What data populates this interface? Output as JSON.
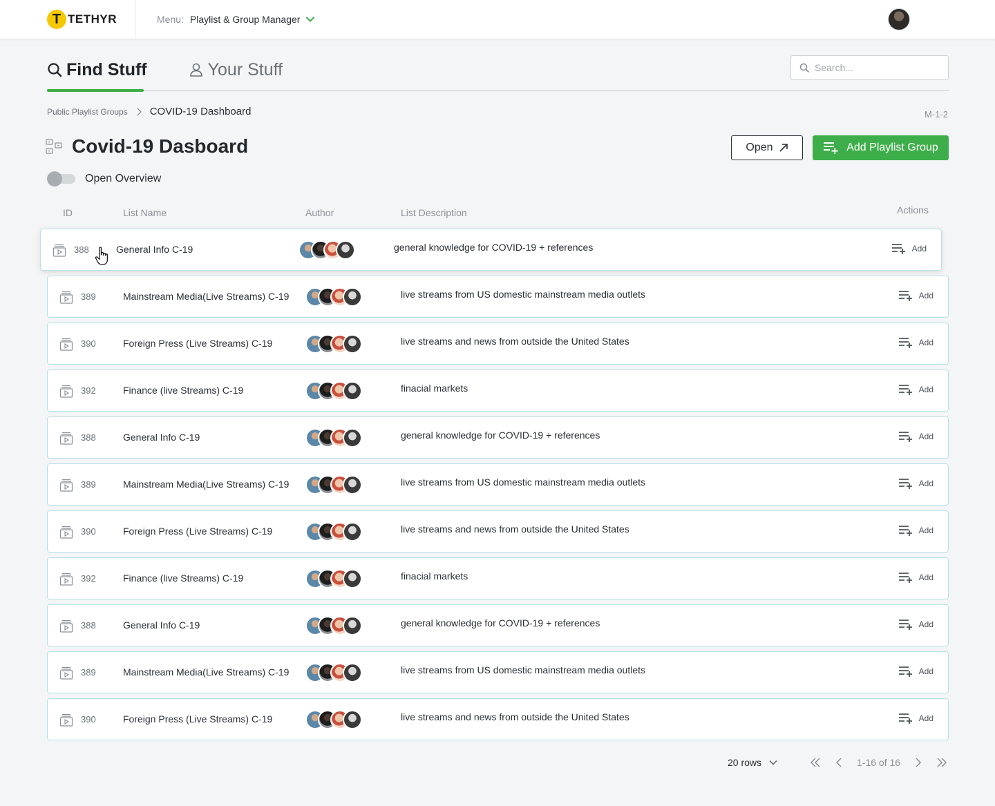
{
  "app": {
    "logo_letter": "T",
    "logo_text": "TETHYR",
    "menu_label": "Menu:",
    "menu_value": "Playlist & Group Manager"
  },
  "tabs": [
    {
      "label": "Find Stuff",
      "active": true
    },
    {
      "label": "Your Stuff",
      "active": false
    }
  ],
  "search": {
    "placeholder": "Search..."
  },
  "breadcrumb": {
    "parent": "Public Playlist Groups",
    "current": "COVID-19 Dashboard"
  },
  "page_code": "M-1-2",
  "page_title": "Covid-19 Dasboard",
  "buttons": {
    "open": "Open",
    "add_group": "Add Playlist Group"
  },
  "toggle": {
    "label": "Open Overview",
    "on": false
  },
  "table": {
    "headers": {
      "id": "ID",
      "name": "List Name",
      "author": "Author",
      "description": "List Description",
      "actions": "Actions"
    },
    "add_label": "Add",
    "rows": [
      {
        "id": "388",
        "name": "General Info C-19",
        "description": "general knowledge for COVID-19 + references"
      },
      {
        "id": "389",
        "name": "Mainstream Media(Live Streams) C-19",
        "description": "live streams from US domestic mainstream media outlets"
      },
      {
        "id": "390",
        "name": "Foreign Press (Live Streams) C-19",
        "description": "live streams and news from outside the United States"
      },
      {
        "id": "392",
        "name": "Finance (live Streams) C-19",
        "description": "finacial markets"
      },
      {
        "id": "388",
        "name": "General Info C-19",
        "description": "general knowledge for COVID-19 + references"
      },
      {
        "id": "389",
        "name": "Mainstream Media(Live Streams) C-19",
        "description": "live streams from US domestic mainstream media outlets"
      },
      {
        "id": "390",
        "name": "Foreign Press (Live Streams) C-19",
        "description": "live streams and news from outside the United States"
      },
      {
        "id": "392",
        "name": "Finance (live Streams) C-19",
        "description": "finacial markets"
      },
      {
        "id": "388",
        "name": "General Info C-19",
        "description": "general knowledge for COVID-19 + references"
      },
      {
        "id": "389",
        "name": "Mainstream Media(Live Streams) C-19",
        "description": "live streams from US domestic mainstream media outlets"
      },
      {
        "id": "390",
        "name": "Foreign Press (Live Streams) C-19",
        "description": "live streams and news from outside the United States"
      }
    ]
  },
  "pagination": {
    "rows_per_page": "20 rows",
    "range": "1-16 of 16"
  },
  "colors": {
    "accent": "#3dae4a",
    "logo_yellow": "#f5c800",
    "row_border": "#b5e2e6"
  },
  "icons": [
    "search-icon",
    "user-icon",
    "chevron-down-icon",
    "chevron-right-icon",
    "playlist-group-icon",
    "external-link-icon",
    "playlist-add-icon",
    "playlist-video-icon",
    "first-page-icon",
    "prev-page-icon",
    "next-page-icon",
    "last-page-icon",
    "hand-cursor-icon"
  ]
}
